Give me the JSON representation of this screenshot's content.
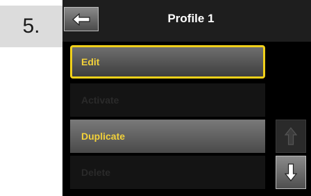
{
  "step": {
    "number": "5."
  },
  "header": {
    "title": "Profile 1",
    "back_icon": "arrow-left-icon"
  },
  "menu": {
    "items": [
      {
        "label": "Edit",
        "state": "focused"
      },
      {
        "label": "Activate",
        "state": "disabled"
      },
      {
        "label": "Duplicate",
        "state": "selected"
      },
      {
        "label": "Delete",
        "state": "disabled"
      }
    ]
  },
  "scroll": {
    "up_icon": "arrow-up-icon",
    "down_icon": "arrow-down-icon"
  },
  "colors": {
    "accent": "#f2d13a",
    "focus_border": "#f1d11a",
    "screen_bg": "#000000",
    "step_bg": "#dcdcdc"
  }
}
